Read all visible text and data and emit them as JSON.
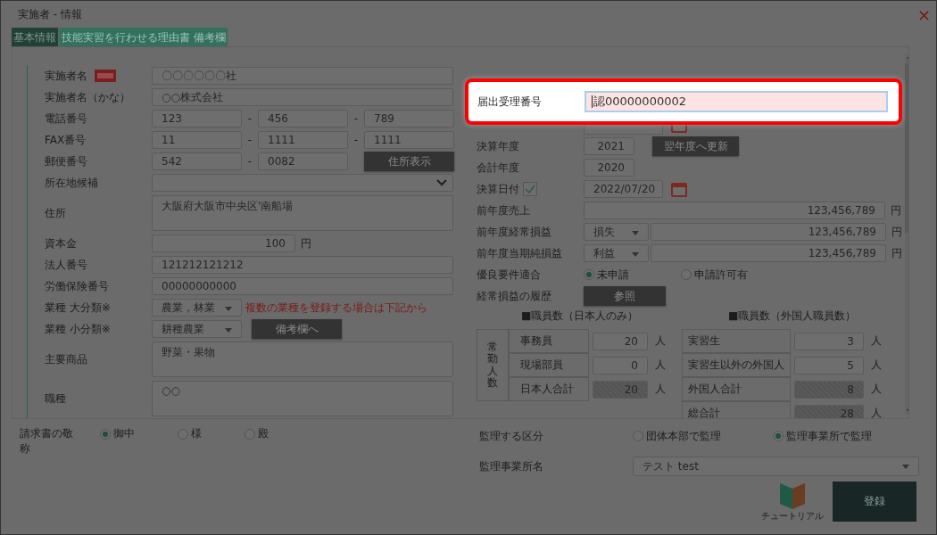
{
  "window": {
    "title": "実施者 - 情報",
    "close": "×"
  },
  "tabs": [
    {
      "label": "基本情報",
      "selected": true
    },
    {
      "label": "技能実習を行わせる理由書",
      "selected": false
    },
    {
      "label": "備考欄",
      "selected": false
    }
  ],
  "left_rows": [
    {
      "kind": "text",
      "label": "実施者名",
      "required": true,
      "value": "〇〇〇〇〇〇社"
    },
    {
      "kind": "text",
      "label": "実施者名（かな）",
      "value": "○○株式会社"
    },
    {
      "kind": "parts",
      "label": "電話番号",
      "parts": [
        "123",
        "456",
        "789"
      ],
      "separators": [
        "-",
        "-"
      ]
    },
    {
      "kind": "parts",
      "label": "FAX番号",
      "parts": [
        "11",
        "1111",
        "1111"
      ],
      "separators": [
        "-",
        "-"
      ]
    },
    {
      "kind": "parts",
      "label": "郵便番号",
      "parts": [
        "542",
        "0082"
      ],
      "separators": [
        "-"
      ],
      "button": "住所表示"
    },
    {
      "kind": "select",
      "label": "所在地候補"
    },
    {
      "kind": "area",
      "label": "住所",
      "value": "大阪府大阪市中央区'南船場"
    },
    {
      "kind": "money",
      "label": "資本金",
      "value": "100",
      "unit": "円"
    },
    {
      "kind": "text",
      "label": "法人番号",
      "value": "121212121212"
    },
    {
      "kind": "text",
      "label": "労働保険番号",
      "value": "00000000000"
    },
    {
      "kind": "category",
      "label": "業種 大分類※",
      "value": "農業，林業",
      "note": "複数の業種を登録する場合は下記から"
    },
    {
      "kind": "category",
      "label": "業種 小分類※",
      "value": "耕種農業",
      "button": "備考欄へ"
    },
    {
      "kind": "area",
      "label": "主要商品",
      "value": "野菜・果物"
    },
    {
      "kind": "area",
      "label": "職種",
      "value": "○○"
    }
  ],
  "highlight": {
    "label": "届出受理番号",
    "value": "認00000000002"
  },
  "right_rows": [
    {
      "kind": "number",
      "label": "決算年度",
      "value": "2021",
      "button": "翌年度へ更新"
    },
    {
      "kind": "number",
      "label": "会計年度",
      "value": "2020"
    },
    {
      "kind": "date",
      "label": "決算日付",
      "checked": true,
      "value": "2022/07/20"
    },
    {
      "kind": "amount",
      "label": "前年度売上",
      "value": "123,456,789",
      "unit": "円"
    },
    {
      "kind": "signed",
      "label": "前年度経常損益",
      "sign": "損失",
      "value": "123,456,789",
      "unit": "円"
    },
    {
      "kind": "signed",
      "label": "前年度当期純損益",
      "sign": "利益",
      "value": "123,456,789",
      "unit": "円"
    },
    {
      "kind": "radio",
      "label": "優良要件適合",
      "options": [
        {
          "label": "未申請",
          "selected": true
        },
        {
          "label": "申請許可有",
          "selected": false
        }
      ]
    },
    {
      "kind": "button",
      "label": "経常損益の履歴",
      "button": "参照"
    }
  ],
  "staff_japanese": {
    "heading": "■職員数（日本人のみ）",
    "group": "常勤人数",
    "rows": [
      {
        "label": "事務員",
        "value": "20",
        "unit": "人",
        "computed": false
      },
      {
        "label": "現場部員",
        "value": "0",
        "unit": "人",
        "computed": false
      },
      {
        "label": "日本人合計",
        "value": "20",
        "unit": "人",
        "computed": true
      }
    ]
  },
  "staff_foreign": {
    "heading": "■職員数（外国人職員数）",
    "rows": [
      {
        "label": "実習生",
        "value": "3",
        "unit": "人",
        "computed": false
      },
      {
        "label": "実習生以外の外国人",
        "value": "5",
        "unit": "人",
        "computed": false
      },
      {
        "label": "外国人合計",
        "value": "8",
        "unit": "人",
        "computed": true
      },
      {
        "label": "総合計",
        "value": "28",
        "unit": "人",
        "computed": true
      }
    ]
  },
  "honorific": {
    "label": "請求書の敬称",
    "options": [
      {
        "label": "御中",
        "selected": true
      },
      {
        "label": "様",
        "selected": false
      },
      {
        "label": "殿",
        "selected": false
      }
    ]
  },
  "supervision": {
    "label": "監理する区分",
    "options": [
      {
        "label": "団体本部で監理",
        "selected": false
      },
      {
        "label": "監理事業所で監理",
        "selected": true
      }
    ]
  },
  "office": {
    "label": "監理事業所名",
    "value": "テスト test"
  },
  "tutorial": {
    "label": "チュートリアル"
  },
  "register": "登録"
}
